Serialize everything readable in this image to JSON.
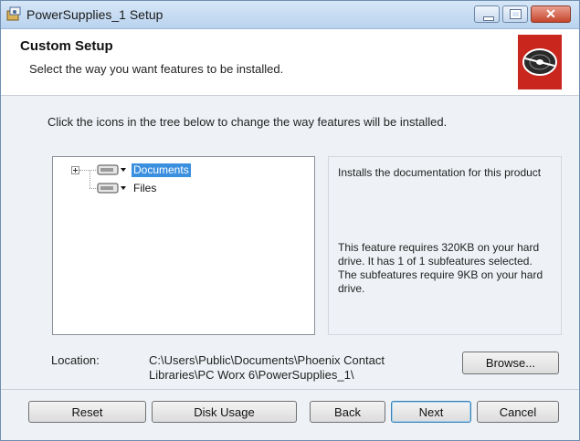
{
  "window": {
    "title": "PowerSupplies_1 Setup",
    "close_glyph": "✕"
  },
  "header": {
    "title": "Custom Setup",
    "subtitle": "Select the way you want features to be installed."
  },
  "instruction": "Click the icons in the tree below to change the way features will be installed.",
  "tree": {
    "items": [
      {
        "label": "Documents",
        "selected": true
      },
      {
        "label": "Files",
        "selected": false
      }
    ]
  },
  "description": {
    "summary": "Installs the documentation for this product",
    "requirements": "This feature requires 320KB on your hard drive. It has 1 of 1 subfeatures selected. The subfeatures require 9KB on your hard drive."
  },
  "location": {
    "label": "Location:",
    "path_line1": "C:\\Users\\Public\\Documents\\Phoenix Contact",
    "path_line2": "Libraries\\PC Worx 6\\PowerSupplies_1\\"
  },
  "buttons": {
    "browse": "Browse...",
    "reset": "Reset",
    "disk_usage": "Disk Usage",
    "back": "Back",
    "next": "Next",
    "cancel": "Cancel"
  },
  "colors": {
    "selection": "#3a8fdf",
    "logo_red": "#c9261d",
    "titlebar": "#c6dcf2"
  },
  "icons": {
    "app": "setup-package-icon",
    "logo": "disc-icon",
    "feature": "hard-drive-dropdown-icon"
  }
}
